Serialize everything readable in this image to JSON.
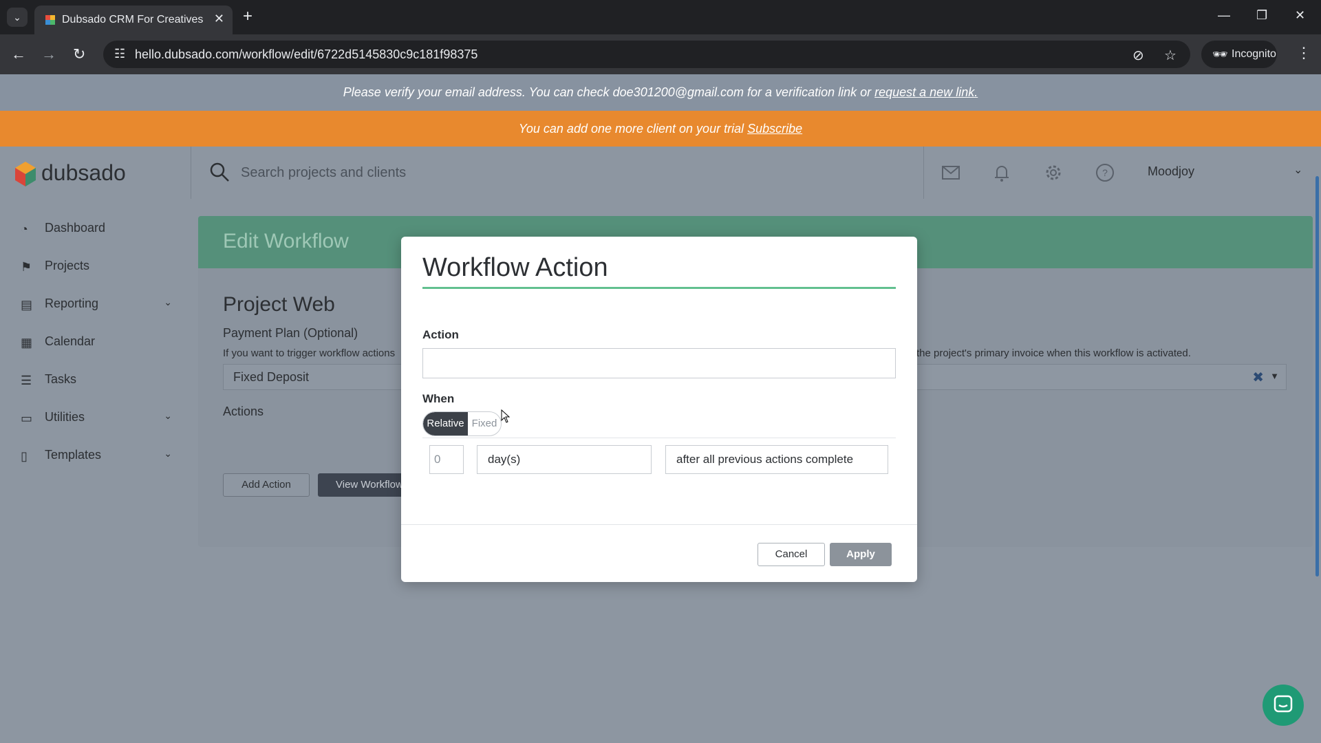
{
  "browser": {
    "tab_title": "Dubsado CRM For Creatives",
    "url": "hello.dubsado.com/workflow/edit/6722d5145830c9c181f98375",
    "incognito_label": "Incognito"
  },
  "banners": {
    "verify_text": "Please verify your email address. You can check doe301200@gmail.com for a verification link or ",
    "verify_link": "request a new link.",
    "trial_text": "You can add one more client on your trial ",
    "trial_link": "Subscribe"
  },
  "header": {
    "logo_text": "dubsado",
    "search_placeholder": "Search projects and clients",
    "user_name": "Moodjoy"
  },
  "sidebar": {
    "items": [
      {
        "label": "Dashboard",
        "icon": "dashboard-icon"
      },
      {
        "label": "Projects",
        "icon": "projects-icon"
      },
      {
        "label": "Reporting",
        "icon": "reporting-icon"
      },
      {
        "label": "Calendar",
        "icon": "calendar-icon"
      },
      {
        "label": "Tasks",
        "icon": "tasks-icon"
      },
      {
        "label": "Utilities",
        "icon": "utilities-icon"
      },
      {
        "label": "Templates",
        "icon": "templates-icon"
      }
    ]
  },
  "page": {
    "card_title": "Edit Workflow",
    "project_name": "Project Web",
    "payment_plan_label": "Payment Plan (Optional)",
    "payment_plan_help_left": "If you want to trigger workflow actions",
    "payment_plan_help_right": "the project's primary invoice when this workflow is activated.",
    "payment_plan_value": "Fixed Deposit",
    "actions_label": "Actions",
    "add_action_label": "Add Action",
    "view_workflow_label": "View Workflow"
  },
  "modal": {
    "title": "Workflow Action",
    "action_label": "Action",
    "action_value": "",
    "when_label": "When",
    "toggle_relative": "Relative",
    "toggle_fixed": "Fixed",
    "toggle_selected": "Relative",
    "number_value": "0",
    "unit_value": "day(s)",
    "timing_value": "after all previous actions complete",
    "cancel_label": "Cancel",
    "apply_label": "Apply"
  },
  "colors": {
    "accent_green": "#62c08f",
    "trial_orange": "#e8892e",
    "header_green": "#55907a"
  }
}
